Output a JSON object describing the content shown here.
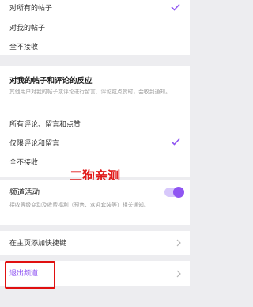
{
  "post_notify": {
    "options": [
      {
        "label": "对所有的帖子",
        "checked": true
      },
      {
        "label": "对我的帖子",
        "checked": false
      },
      {
        "label": "全不接收",
        "checked": false
      }
    ]
  },
  "reactions": {
    "title": "对我的帖子和评论的反应",
    "description": "其他用户对我的帖子或评论进行留言、评论或点赞时，会收到通知。",
    "options": [
      {
        "label": "所有评论、留言和点赞",
        "checked": false
      },
      {
        "label": "仅限评论和留言",
        "checked": true
      },
      {
        "label": "全不接收",
        "checked": false
      }
    ]
  },
  "channel_activity": {
    "title": "频道活动",
    "description": "接收等级变动及收费福利（预售、欢迎套装等）相关通知。",
    "enabled": true
  },
  "shortcut": {
    "label": "在主页添加快捷键"
  },
  "leave": {
    "label": "退出频道"
  },
  "watermark": "二狗亲测",
  "colors": {
    "accent": "#8f55f2",
    "danger": "#e01010",
    "watermark": "#e11a1a"
  }
}
